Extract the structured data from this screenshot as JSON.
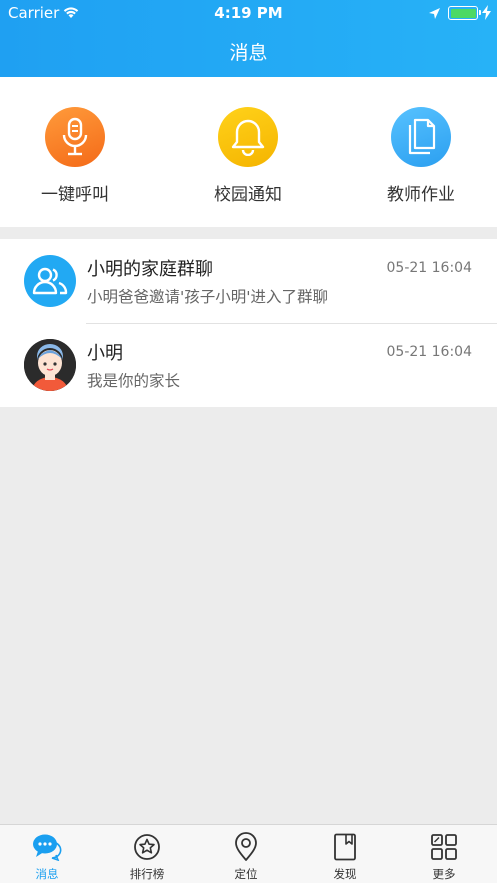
{
  "status_bar": {
    "carrier": "Carrier",
    "time": "4:19 PM"
  },
  "header": {
    "title": "消息"
  },
  "quick_actions": [
    {
      "label": "一键呼叫",
      "icon": "microphone-icon",
      "color": "#f47a20"
    },
    {
      "label": "校园通知",
      "icon": "bell-icon",
      "color": "#f7c200"
    },
    {
      "label": "教师作业",
      "icon": "document-icon",
      "color": "#3aaaf5"
    }
  ],
  "messages": [
    {
      "title": "小明的家庭群聊",
      "time": "05-21 16:04",
      "preview": "小明爸爸邀请'孩子小明'进入了群聊",
      "avatar": "group-avatar"
    },
    {
      "title": "小明",
      "time": "05-21 16:04",
      "preview": "我是你的家长",
      "avatar": "child-avatar"
    }
  ],
  "tab_bar": {
    "active": "消息",
    "accent": "#1a9ff0",
    "tabs": [
      {
        "label": "消息",
        "icon": "chat-bubble-icon"
      },
      {
        "label": "排行榜",
        "icon": "star-badge-icon"
      },
      {
        "label": "定位",
        "icon": "location-pin-icon"
      },
      {
        "label": "发现",
        "icon": "bookmark-book-icon"
      },
      {
        "label": "更多",
        "icon": "grid-icon"
      }
    ]
  }
}
